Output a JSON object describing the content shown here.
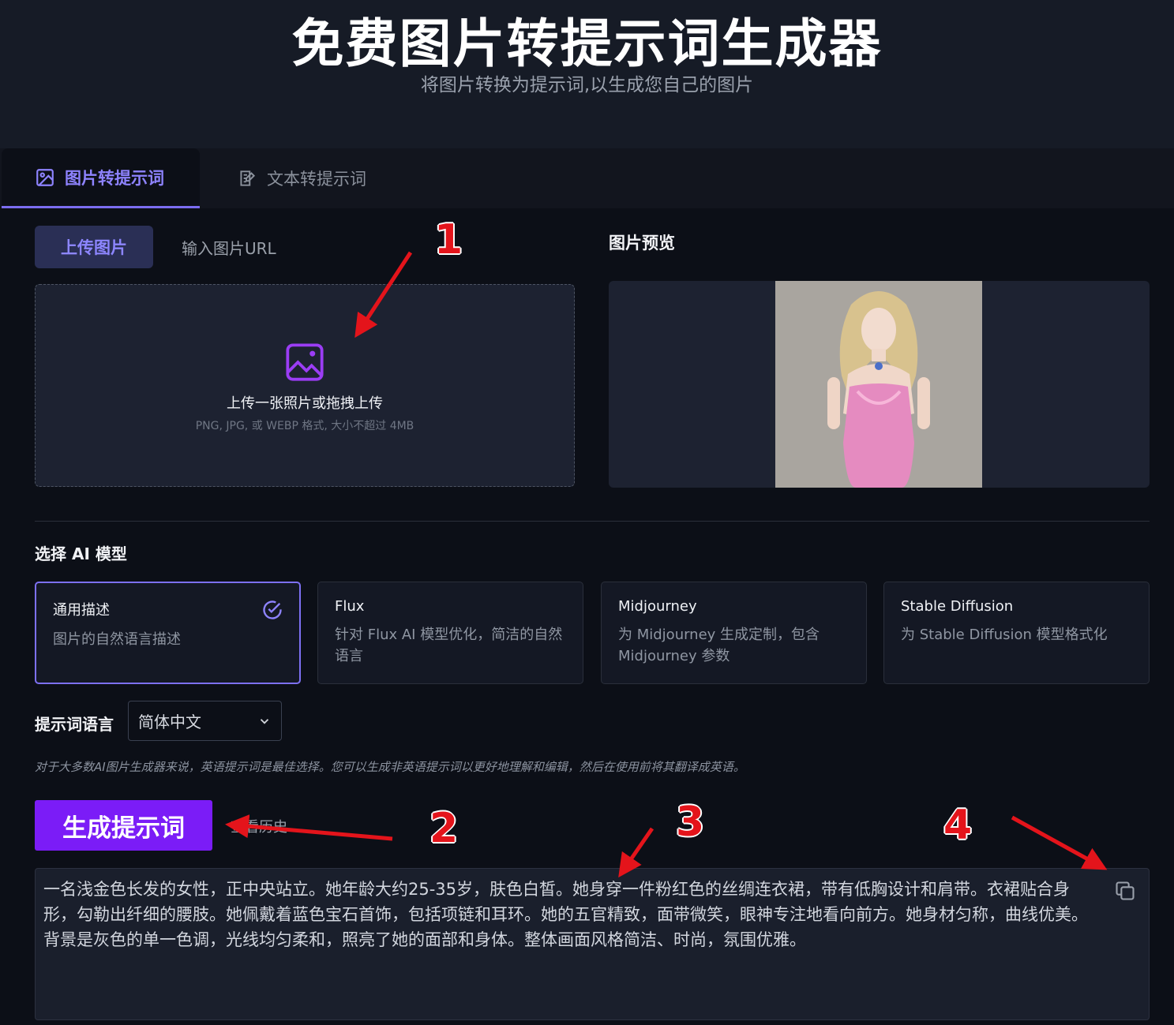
{
  "hero": {
    "title": "免费图片转提示词生成器",
    "subtitle": "将图片转换为提示词,以生成您自己的图片"
  },
  "tabs": [
    {
      "label": "图片转提示词",
      "icon": "image-prompt-icon",
      "active": true
    },
    {
      "label": "文本转提示词",
      "icon": "text-prompt-icon",
      "active": false
    }
  ],
  "upload": {
    "tab_upload": "上传图片",
    "tab_url": "输入图片URL",
    "drop_title": "上传一张照片或拖拽上传",
    "drop_subtitle": "PNG, JPG, 或 WEBP 格式, 大小不超过 4MB"
  },
  "preview": {
    "title": "图片预览"
  },
  "models": {
    "label": "选择 AI 模型",
    "items": [
      {
        "name": "通用描述",
        "desc": "图片的自然语言描述",
        "selected": true
      },
      {
        "name": "Flux",
        "desc": "针对 Flux AI 模型优化，简洁的自然语言",
        "selected": false
      },
      {
        "name": "Midjourney",
        "desc": "为 Midjourney 生成定制，包含 Midjourney 参数",
        "selected": false
      },
      {
        "name": "Stable Diffusion",
        "desc": "为 Stable Diffusion 模型格式化",
        "selected": false
      }
    ]
  },
  "language": {
    "label": "提示词语言",
    "value": "简体中文",
    "hint": "对于大多数AI图片生成器来说，英语提示词是最佳选择。您可以生成非英语提示词以更好地理解和编辑，然后在使用前将其翻译成英语。"
  },
  "actions": {
    "generate": "生成提示词",
    "history": "查看历史"
  },
  "output": {
    "text": "一名浅金色长发的女性，正中央站立。她年龄大约25-35岁，肤色白皙。她身穿一件粉红色的丝绸连衣裙，带有低胸设计和肩带。衣裙贴合身形，勾勒出纤细的腰肢。她佩戴着蓝色宝石首饰，包括项链和耳环。她的五官精致，面带微笑，眼神专注地看向前方。她身材匀称，曲线优美。背景是灰色的单一色调，光线均匀柔和，照亮了她的面部和身体。整体画面风格简洁、时尚，氛围优雅。"
  },
  "annotations": [
    "1",
    "2",
    "3",
    "4"
  ],
  "colors": {
    "accent": "#7b6cf0",
    "generate_button": "#7b1cf7",
    "annotation_red": "#e4141b"
  }
}
